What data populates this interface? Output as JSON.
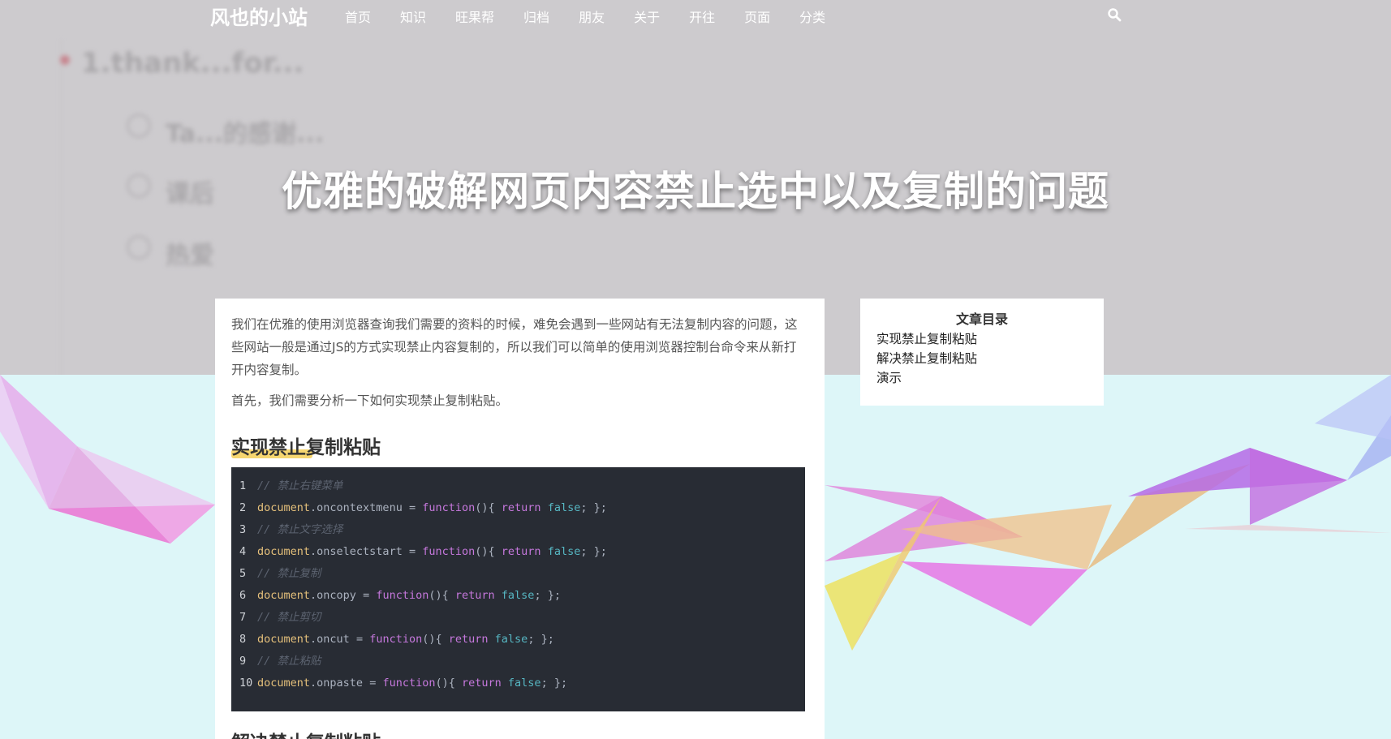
{
  "site": {
    "brand": "风也的小站"
  },
  "nav": {
    "items": [
      {
        "label": "首页"
      },
      {
        "label": "知识"
      },
      {
        "label": "旺果帮"
      },
      {
        "label": "归档"
      },
      {
        "label": "朋友"
      },
      {
        "label": "关于"
      },
      {
        "label": "开往"
      },
      {
        "label": "页面"
      },
      {
        "label": "分类"
      }
    ],
    "search_icon": "search-icon"
  },
  "hero": {
    "title": "优雅的破解网页内容禁止选中以及复制的问题",
    "blurred_bg": [
      "1.thank...for...",
      "Ta...的感谢...",
      "课后",
      "热爱"
    ]
  },
  "article": {
    "para1": "我们在优雅的使用浏览器查询我们需要的资料的时候，难免会遇到一些网站有无法复制内容的问题，这些网站一般是通过JS的方式实现禁止内容复制的，所以我们可以简单的使用浏览器控制台命令来从新打开内容复制。",
    "para2": "首先，我们需要分析一下如何实现禁止复制粘贴。",
    "heading1": "实现禁止复制粘贴",
    "heading2": "解决禁止复制粘贴",
    "code": [
      {
        "n": "1",
        "comment": "// 禁止右键菜单"
      },
      {
        "n": "2",
        "obj": "document",
        "prop": ".oncontextmenu",
        "eq": " = ",
        "fn": "function",
        "mid": "(){ ",
        "ret": "return",
        "sp": " ",
        "val": "false",
        "end": "; };"
      },
      {
        "n": "3",
        "comment": "// 禁止文字选择"
      },
      {
        "n": "4",
        "obj": "document",
        "prop": ".onselectstart",
        "eq": " = ",
        "fn": "function",
        "mid": "(){ ",
        "ret": "return",
        "sp": " ",
        "val": "false",
        "end": "; };"
      },
      {
        "n": "5",
        "comment": "// 禁止复制"
      },
      {
        "n": "6",
        "obj": "document",
        "prop": ".oncopy",
        "eq": " = ",
        "fn": "function",
        "mid": "(){ ",
        "ret": "return",
        "sp": " ",
        "val": "false",
        "end": "; };"
      },
      {
        "n": "7",
        "comment": "// 禁止剪切"
      },
      {
        "n": "8",
        "obj": "document",
        "prop": ".oncut",
        "eq": " = ",
        "fn": "function",
        "mid": "(){ ",
        "ret": "return",
        "sp": " ",
        "val": "false",
        "end": "; };"
      },
      {
        "n": "9",
        "comment": "// 禁止粘贴"
      },
      {
        "n": "10",
        "obj": "document",
        "prop": ".onpaste",
        "eq": " = ",
        "fn": "function",
        "mid": "(){ ",
        "ret": "return",
        "sp": " ",
        "val": "false",
        "end": "; };"
      }
    ]
  },
  "toc": {
    "title": "文章目录",
    "items": [
      {
        "label": "实现禁止复制粘贴"
      },
      {
        "label": "解决禁止复制粘贴"
      },
      {
        "label": "演示"
      }
    ]
  },
  "colors": {
    "hero_bg": "#cdcbce",
    "page_bg": "#ddf6f8",
    "code_bg": "#282c34",
    "heading_highlight": "#f5cf57"
  }
}
